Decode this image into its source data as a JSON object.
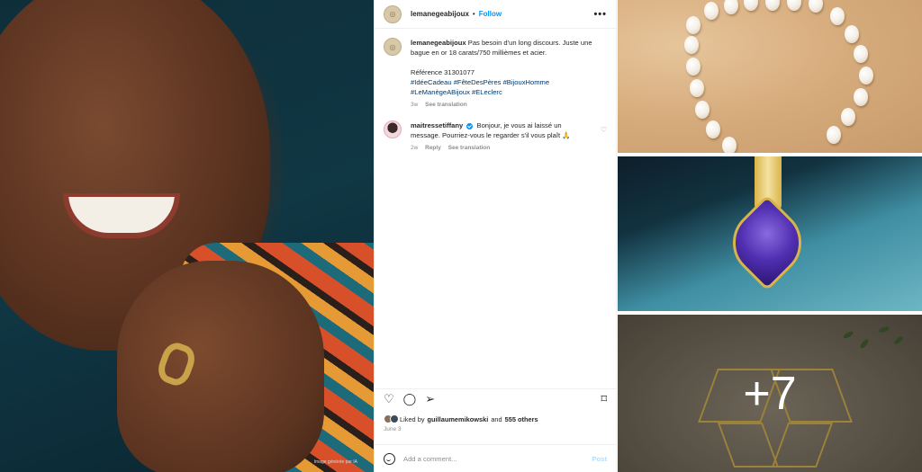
{
  "left_photo": {
    "credit": "Image générée par IA"
  },
  "post": {
    "username": "lemanegeabijoux",
    "follow_label": "Follow",
    "more_label": "•••",
    "caption": {
      "username": "lemanegeabijoux",
      "text": "Pas besoin d'un long discours. Juste une bague en or 18 carats/750 millièmes et acier.",
      "reference": "Référence 31301077",
      "hashtags": "#IdéeCadeau #FêteDesPères #BijouxHomme #LeManègeABijoux #ELeclerc",
      "time": "3w",
      "see_translation": "See translation"
    },
    "comment": {
      "username": "maitressetiffany",
      "text": "Bonjour, je vous ai laissé un message. Pourriez-vous le regarder s'il vous plaît 🙏",
      "time": "2w",
      "reply": "Reply",
      "see_translation": "See translation"
    },
    "likes": {
      "prefix": "Liked by",
      "user": "guillaumemikowski",
      "and": "and",
      "count": "555 others"
    },
    "date": "June 3",
    "add_comment_placeholder": "Add a comment...",
    "post_label": "Post"
  },
  "gallery": {
    "more_count": "+7"
  },
  "icons": [
    "heart-icon",
    "comment-icon",
    "share-icon",
    "bookmark-icon",
    "emoji-icon",
    "more-icon",
    "verified-icon"
  ],
  "colors": {
    "link_blue": "#0095f6",
    "hashtag_blue": "#00376b",
    "muted": "#8e8e8e"
  }
}
